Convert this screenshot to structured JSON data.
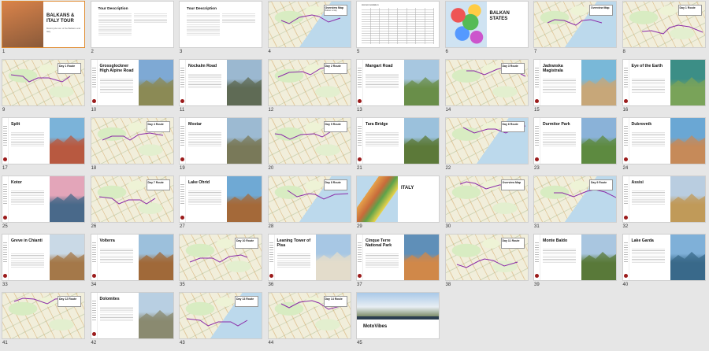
{
  "colors": {
    "accent": "#9b1b1b",
    "selection": "#e08a2e",
    "background": "#e6e6e6"
  },
  "slides": [
    {
      "number": "1",
      "type": "title",
      "title": "BALKANS & ITALY TOUR",
      "subtitle": "Motorcycle tour of the Balkans and Italy",
      "photo": [
        "#d9834a",
        "#8a5a3a"
      ]
    },
    {
      "number": "2",
      "type": "desc",
      "title": "Tour Description"
    },
    {
      "number": "3",
      "type": "desc",
      "title": "Tour Description"
    },
    {
      "number": "4",
      "type": "map",
      "label": "Overview Map",
      "sub": "Balkan & Italy"
    },
    {
      "number": "5",
      "type": "table",
      "title": "Accommodation"
    },
    {
      "number": "6",
      "type": "states",
      "title": "BALKAN STATES"
    },
    {
      "number": "7",
      "type": "map",
      "label": "Overview Map",
      "sub": ""
    },
    {
      "number": "8",
      "type": "map",
      "label": "Day 1 Route",
      "sub": ""
    },
    {
      "number": "9",
      "type": "map",
      "label": "Day 1 Route",
      "sub": ""
    },
    {
      "number": "10",
      "type": "photo",
      "title": "Grossglockner High Alpine Road",
      "photo": [
        "#7ea9d4",
        "#8b8a55"
      ]
    },
    {
      "number": "11",
      "type": "photo",
      "title": "Nockalm Road",
      "photo": [
        "#9bb8d0",
        "#5f6b55"
      ]
    },
    {
      "number": "12",
      "type": "map",
      "label": "Day 2 Route",
      "sub": ""
    },
    {
      "number": "13",
      "type": "photo",
      "title": "Mangart Road",
      "photo": [
        "#a7c7e0",
        "#6a8e4a"
      ]
    },
    {
      "number": "14",
      "type": "map",
      "label": "Day 3 Route",
      "sub": ""
    },
    {
      "number": "15",
      "type": "photo",
      "title": "Jadranska Magistrala",
      "photo": [
        "#79b8d8",
        "#c7a77a"
      ]
    },
    {
      "number": "16",
      "type": "photo",
      "title": "Eye of the Earth",
      "photo": [
        "#3c8e86",
        "#7aa35a"
      ]
    },
    {
      "number": "17",
      "type": "photo",
      "title": "Split",
      "photo": [
        "#7bb3d9",
        "#b85a40"
      ]
    },
    {
      "number": "18",
      "type": "map",
      "label": "Day 4 Route",
      "sub": ""
    },
    {
      "number": "19",
      "type": "photo",
      "title": "Mostar",
      "photo": [
        "#9cbad2",
        "#7a7a5a"
      ]
    },
    {
      "number": "20",
      "type": "map",
      "label": "Day 5 Route",
      "sub": ""
    },
    {
      "number": "21",
      "type": "photo",
      "title": "Tara Bridge",
      "photo": [
        "#9bc1dc",
        "#5c7a3a"
      ]
    },
    {
      "number": "22",
      "type": "map",
      "label": "Day 6 Route",
      "sub": ""
    },
    {
      "number": "23",
      "type": "photo",
      "title": "Durmitor Park",
      "photo": [
        "#8ab2d8",
        "#5e8a40"
      ]
    },
    {
      "number": "24",
      "type": "photo",
      "title": "Dubrovnik",
      "photo": [
        "#6aa7d4",
        "#c58a5a"
      ]
    },
    {
      "number": "25",
      "type": "photo",
      "title": "Kotor",
      "photo": [
        "#e3a5b9",
        "#4a6a8a"
      ]
    },
    {
      "number": "26",
      "type": "map",
      "label": "Day 7 Route",
      "sub": ""
    },
    {
      "number": "27",
      "type": "photo",
      "title": "Lake Ohrid",
      "photo": [
        "#6fa9d4",
        "#a46a3a"
      ]
    },
    {
      "number": "28",
      "type": "map",
      "label": "Day 8 Route",
      "sub": ""
    },
    {
      "number": "29",
      "type": "italy",
      "title": "ITALY"
    },
    {
      "number": "30",
      "type": "map",
      "label": "Overview Map",
      "sub": ""
    },
    {
      "number": "31",
      "type": "map",
      "label": "Day 9 Route",
      "sub": ""
    },
    {
      "number": "32",
      "type": "photo",
      "title": "Assisi",
      "photo": [
        "#b9cde0",
        "#c09a5a"
      ]
    },
    {
      "number": "33",
      "type": "photo",
      "title": "Greve in Chianti",
      "photo": [
        "#c9d9e6",
        "#a4784a"
      ]
    },
    {
      "number": "34",
      "type": "photo",
      "title": "Volterra",
      "photo": [
        "#9cc0dc",
        "#a06a3a"
      ]
    },
    {
      "number": "35",
      "type": "map",
      "label": "Day 10 Route",
      "sub": ""
    },
    {
      "number": "36",
      "type": "photo",
      "title": "Leaning Tower of Pisa",
      "photo": [
        "#a7c7e4",
        "#e3dccb"
      ]
    },
    {
      "number": "37",
      "type": "photo",
      "title": "Cinque Terre National Park",
      "photo": [
        "#5f8fb8",
        "#d0884a"
      ]
    },
    {
      "number": "38",
      "type": "map",
      "label": "Day 11 Route",
      "sub": ""
    },
    {
      "number": "39",
      "type": "photo",
      "title": "Monte Baldo",
      "photo": [
        "#a9c6e0",
        "#5a7a3a"
      ]
    },
    {
      "number": "40",
      "type": "photo",
      "title": "Lake Garda",
      "photo": [
        "#7fb0d8",
        "#3a6a8a"
      ]
    },
    {
      "number": "41",
      "type": "map",
      "label": "Day 12 Route",
      "sub": ""
    },
    {
      "number": "42",
      "type": "photo",
      "title": "Dolomites",
      "photo": [
        "#b8cfe2",
        "#8a8a70"
      ]
    },
    {
      "number": "43",
      "type": "map",
      "label": "Day 13 Route",
      "sub": ""
    },
    {
      "number": "44",
      "type": "map",
      "label": "Day 14 Route",
      "sub": ""
    },
    {
      "number": "45",
      "type": "brand",
      "title": "MotoVibes"
    }
  ]
}
